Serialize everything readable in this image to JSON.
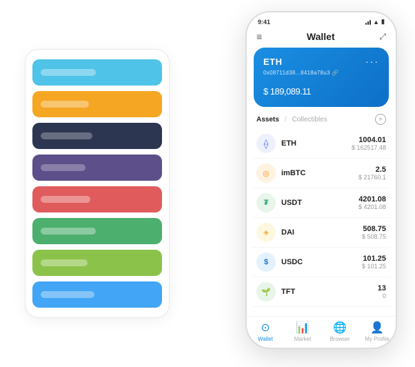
{
  "scene": {
    "background": "#ffffff"
  },
  "cardStack": {
    "cards": [
      {
        "id": "blue",
        "colorClass": "card-blue",
        "lineClass": "line-blue",
        "iconText": ""
      },
      {
        "id": "orange",
        "colorClass": "card-orange",
        "lineClass": "line-orange",
        "iconText": ""
      },
      {
        "id": "dark",
        "colorClass": "card-dark",
        "lineClass": "line-dark",
        "iconText": ""
      },
      {
        "id": "purple",
        "colorClass": "card-purple",
        "lineClass": "line-purple",
        "iconText": ""
      },
      {
        "id": "red",
        "colorClass": "card-red",
        "lineClass": "line-red",
        "iconText": ""
      },
      {
        "id": "green",
        "colorClass": "card-green",
        "lineClass": "line-green",
        "iconText": ""
      },
      {
        "id": "lightgreen",
        "colorClass": "card-lightgreen",
        "lineClass": "line-lightgreen",
        "iconText": ""
      },
      {
        "id": "skyblue",
        "colorClass": "card-skyblue",
        "lineClass": "line-skyblue",
        "iconText": ""
      }
    ]
  },
  "phone": {
    "statusBar": {
      "time": "9:41",
      "battery": "▮▮▮"
    },
    "header": {
      "menuIcon": "≡",
      "title": "Wallet",
      "expandIcon": "⤢"
    },
    "ethCard": {
      "label": "ETH",
      "dots": "···",
      "address": "0x08711d38...8418a78u3  🔗",
      "currency": "$",
      "amount": "189,089.11"
    },
    "assetsSection": {
      "tabActive": "Assets",
      "divider": "/",
      "tabInactive": "Collectibles",
      "addIcon": "+"
    },
    "assets": [
      {
        "name": "ETH",
        "icon": "⟠",
        "iconBg": "#627eea",
        "amount": "1004.01",
        "usdValue": "$ 162517.48"
      },
      {
        "name": "imBTC",
        "icon": "◎",
        "iconBg": "#f7931a",
        "amount": "2.5",
        "usdValue": "$ 21760.1"
      },
      {
        "name": "USDT",
        "icon": "₮",
        "iconBg": "#26a17b",
        "amount": "4201.08",
        "usdValue": "$ 4201.08"
      },
      {
        "name": "DAI",
        "icon": "◈",
        "iconBg": "#f5ac37",
        "amount": "508.75",
        "usdValue": "$ 508.75"
      },
      {
        "name": "USDC",
        "icon": "$",
        "iconBg": "#2775ca",
        "amount": "101.25",
        "usdValue": "$ 101.25"
      },
      {
        "name": "TFT",
        "icon": "🌱",
        "iconBg": "#4caf50",
        "amount": "13",
        "usdValue": "0"
      }
    ],
    "bottomNav": [
      {
        "id": "wallet",
        "icon": "⊙",
        "label": "Wallet",
        "active": true
      },
      {
        "id": "market",
        "icon": "📈",
        "label": "Market",
        "active": false
      },
      {
        "id": "browser",
        "icon": "🌐",
        "label": "Browser",
        "active": false
      },
      {
        "id": "profile",
        "icon": "👤",
        "label": "My Profile",
        "active": false
      }
    ]
  }
}
